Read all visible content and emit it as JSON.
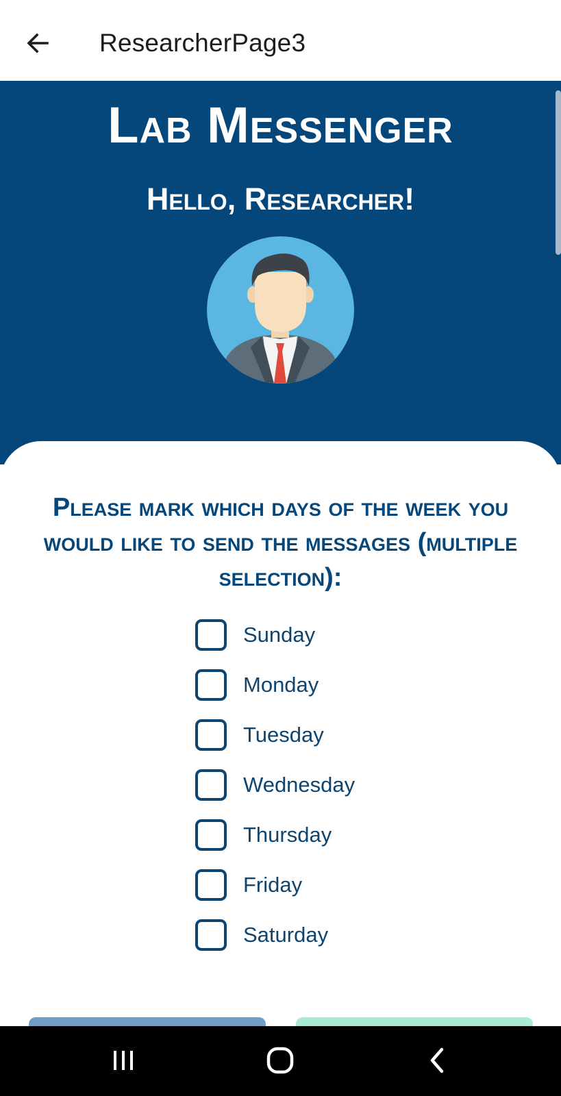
{
  "appbar": {
    "title": "ResearcherPage3",
    "back_icon": "arrow-left-icon"
  },
  "header": {
    "app_title": "Lab Messenger",
    "greeting": "Hello, Researcher!",
    "avatar_icon": "researcher-avatar-icon"
  },
  "form": {
    "question": "Please mark which days of the week you would like to send the messages (multiple selection):",
    "days": [
      {
        "label": "Sunday",
        "checked": false
      },
      {
        "label": "Monday",
        "checked": false
      },
      {
        "label": "Tuesday",
        "checked": false
      },
      {
        "label": "Wednesday",
        "checked": false
      },
      {
        "label": "Thursday",
        "checked": false
      },
      {
        "label": "Friday",
        "checked": false
      },
      {
        "label": "Saturday",
        "checked": false
      }
    ]
  },
  "colors": {
    "primary": "#05477a",
    "text_dark": "#0d4470",
    "button_left": "#6f9fc9",
    "button_right": "#a9ead7"
  },
  "system_nav": {
    "recents_icon": "recent-apps-icon",
    "home_icon": "home-icon",
    "back_icon": "back-chevron-icon"
  }
}
